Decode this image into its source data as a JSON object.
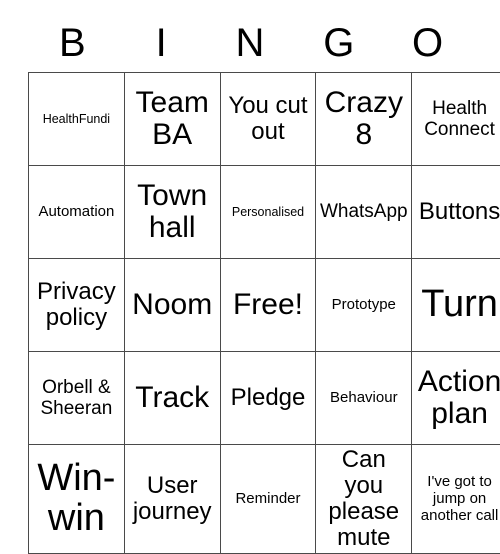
{
  "card": {
    "title": "BINGO",
    "header_letters": [
      "B",
      "I",
      "N",
      "G",
      "O"
    ],
    "colors": {
      "background": "#ffffff",
      "text": "#000000",
      "grid_line": "#4a4a4a"
    },
    "grid": {
      "rows": 5,
      "columns": 5,
      "cells": [
        [
          {
            "text": "HealthFundi",
            "size": "xs",
            "marked": false
          },
          {
            "text": "Team BA",
            "size": "xl",
            "marked": false
          },
          {
            "text": "You cut out",
            "size": "lg",
            "marked": false
          },
          {
            "text": "Crazy 8",
            "size": "xl",
            "marked": false
          },
          {
            "text": "Health Connect",
            "size": "md",
            "marked": false
          }
        ],
        [
          {
            "text": "Automation",
            "size": "sm",
            "marked": false
          },
          {
            "text": "Town hall",
            "size": "xl",
            "marked": false
          },
          {
            "text": "Personalised",
            "size": "xs",
            "marked": false
          },
          {
            "text": "WhatsApp",
            "size": "md",
            "marked": false
          },
          {
            "text": "Buttons",
            "size": "lg",
            "marked": false
          }
        ],
        [
          {
            "text": "Privacy policy",
            "size": "lg",
            "marked": false
          },
          {
            "text": "Noom",
            "size": "xl",
            "marked": false
          },
          {
            "text": "Free!",
            "size": "xl",
            "marked": false
          },
          {
            "text": "Prototype",
            "size": "sm",
            "marked": false
          },
          {
            "text": "Turn",
            "size": "xxl",
            "marked": false
          }
        ],
        [
          {
            "text": "Orbell & Sheeran",
            "size": "md",
            "marked": false
          },
          {
            "text": "Track",
            "size": "xl",
            "marked": false
          },
          {
            "text": "Pledge",
            "size": "lg",
            "marked": false
          },
          {
            "text": "Behaviour",
            "size": "sm",
            "marked": false
          },
          {
            "text": "Action plan",
            "size": "xl",
            "marked": false
          }
        ],
        [
          {
            "text": "Win-win",
            "size": "xxl",
            "marked": false
          },
          {
            "text": "User journey",
            "size": "lg",
            "marked": false
          },
          {
            "text": "Reminder",
            "size": "sm",
            "marked": false
          },
          {
            "text": "Can you please mute",
            "size": "lg",
            "marked": false
          },
          {
            "text": "I've got to jump on another call",
            "size": "sm",
            "marked": false
          }
        ]
      ]
    }
  }
}
